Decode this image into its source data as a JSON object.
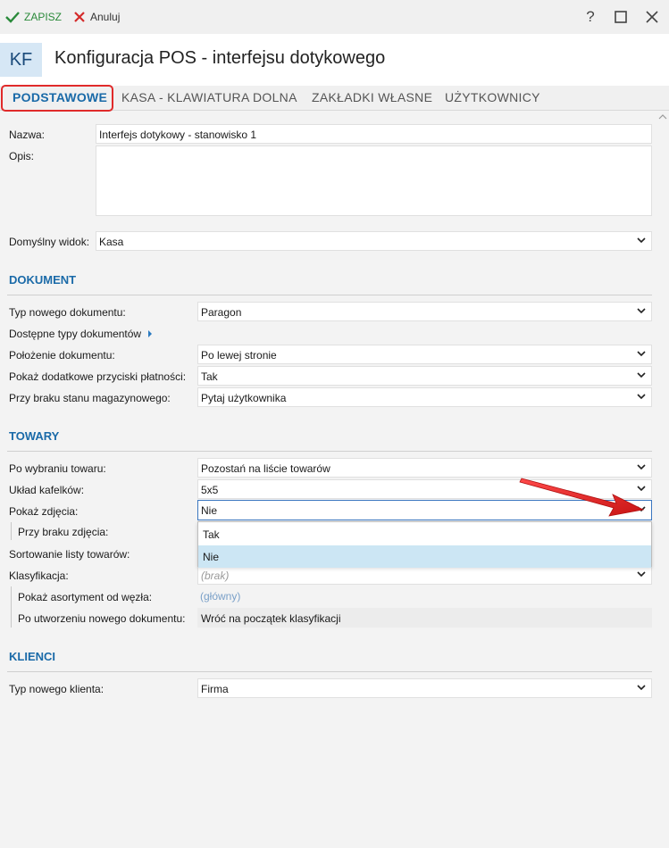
{
  "toolbar": {
    "save_label": "ZAPISZ",
    "cancel_label": "Anuluj"
  },
  "window": {
    "help": "?"
  },
  "header": {
    "badge": "KF",
    "title": "Konfiguracja POS - interfejsu dotykowego"
  },
  "tabs": [
    {
      "label": "PODSTAWOWE"
    },
    {
      "label": "KASA - KLAWIATURA DOLNA"
    },
    {
      "label": "ZAKŁADKI WŁASNE"
    },
    {
      "label": "UŻYTKOWNICY"
    }
  ],
  "basic": {
    "name_label": "Nazwa:",
    "name_value": "Interfejs dotykowy - stanowisko 1",
    "desc_label": "Opis:",
    "view_label": "Domyślny widok:",
    "view_value": "Kasa"
  },
  "document": {
    "title": "DOKUMENT",
    "type_label": "Typ nowego dokumentu:",
    "type_value": "Paragon",
    "available_label": "Dostępne typy dokumentów",
    "position_label": "Położenie dokumentu:",
    "position_value": "Po lewej stronie",
    "extra_pay_label": "Pokaż dodatkowe przyciski płatności:",
    "extra_pay_value": "Tak",
    "stock_label": "Przy braku stanu magazynowego:",
    "stock_value": "Pytaj użytkownika"
  },
  "goods": {
    "title": "TOWARY",
    "after_select_label": "Po wybraniu towaru:",
    "after_select_value": "Pozostań na liście towarów",
    "tiles_label": "Układ kafelków:",
    "tiles_value": "5x5",
    "photos_label": "Pokaż zdjęcia:",
    "photos_value": "Nie",
    "no_photo_label": "Przy braku zdjęcia:",
    "sort_label": "Sortowanie listy towarów:",
    "class_label": "Klasyfikacja:",
    "class_value": "(brak)",
    "assort_label": "Pokaż asortyment od węzła:",
    "assort_value": "(główny)",
    "after_new_label": "Po utworzeniu nowego dokumentu:",
    "after_new_value": "Wróć na początek klasyfikacji",
    "dropdown_options": [
      "Tak",
      "Nie"
    ]
  },
  "clients": {
    "title": "KLIENCI",
    "type_label": "Typ nowego klienta:",
    "type_value": "Firma"
  },
  "colors": {
    "accent": "#1a6aa8",
    "highlight": "#e02a2a",
    "selected": "#cce6f4"
  }
}
